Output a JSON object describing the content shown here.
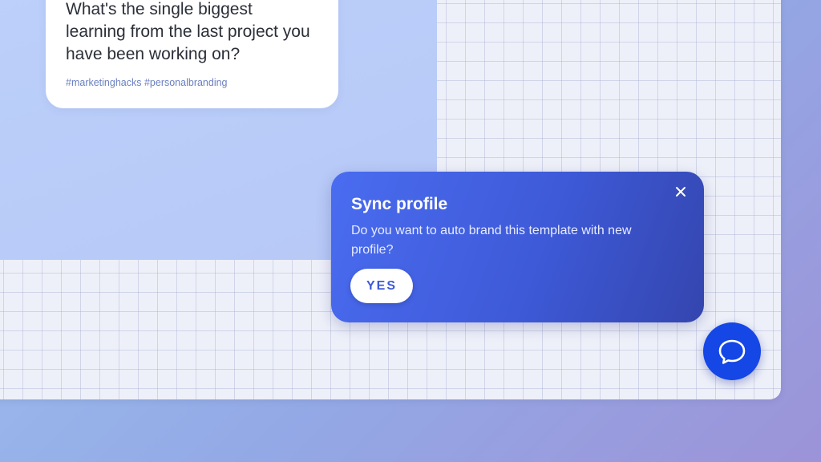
{
  "post_card": {
    "text": "What's the single biggest learning from the last project you have been working on?",
    "hashtags": "#marketinghacks #personalbranding"
  },
  "sync_popup": {
    "title": "Sync profile",
    "message": "Do you want to auto brand this template with new profile?",
    "yes_label": "YES",
    "close_icon": "close-icon"
  },
  "chat_button": {
    "icon": "chat-bubble-icon"
  },
  "colors": {
    "popup_gradient_start": "#4a6cf0",
    "popup_gradient_end": "#3445ae",
    "chat_button": "#1546e6",
    "yes_text": "#3f5ad4",
    "hashtag": "#6a7fc0"
  }
}
